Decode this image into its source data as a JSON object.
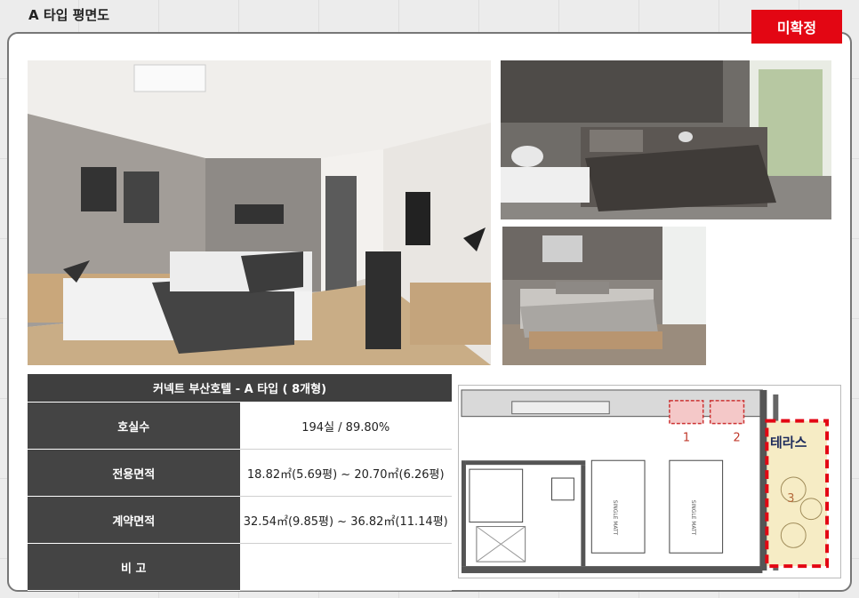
{
  "header": {
    "title": "A 타입 평면도"
  },
  "status_badge": {
    "label": "미확정"
  },
  "table": {
    "title": "커넥트 부산호텔 - A 타입 ( 8개형)",
    "rows": [
      {
        "label": "호실수",
        "value": "194실 / 89.80%"
      },
      {
        "label": "전용면적",
        "value": "18.82㎡(5.69평) ~ 20.70㎡(6.26평)"
      },
      {
        "label": "계약면적",
        "value": "32.54㎡(9.85평) ~ 36.82㎡(11.14평)"
      },
      {
        "label": "비  고",
        "value": ""
      }
    ]
  },
  "floor_plan": {
    "terrace_label": "테라스",
    "marker_1": "1",
    "marker_2": "2",
    "marker_3": "3",
    "bed_label_1": "SINGLE MATT",
    "bed_label_2": "SINGLE MATT"
  },
  "colors": {
    "badge": "#e30613",
    "label_cell": "#444444",
    "highlight": "#e30613",
    "terrace_fill": "#f6ecc5"
  }
}
